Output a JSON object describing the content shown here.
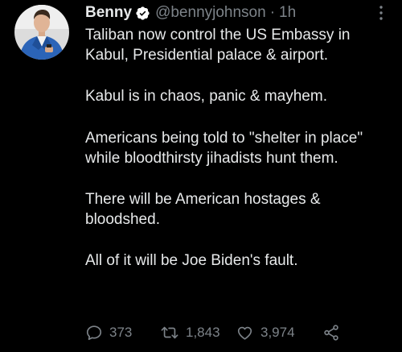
{
  "tweet": {
    "author": {
      "name": "Benny",
      "handle": "@bennyjohnson",
      "time": "1h"
    },
    "separator": "·",
    "body": [
      "Taliban now control the US Embassy in Kabul, Presidential palace & airport.",
      "Kabul is in chaos, panic & mayhem.",
      "Americans being told to \"shelter in place\" while bloodthirsty jihadists hunt them.",
      "There will be American hostages & bloodshed.",
      "All of it will be Joe Biden's fault."
    ],
    "actions": {
      "replies": "373",
      "retweets": "1,843",
      "likes": "3,974"
    },
    "icons": {
      "verified": "verified-badge-icon",
      "more": "more-options-icon",
      "reply": "reply-icon",
      "retweet": "retweet-icon",
      "like": "heart-icon",
      "share": "share-icon"
    },
    "colors": {
      "background": "#000000",
      "text": "#e7e9ea",
      "secondary": "#7d8389",
      "verified": "#ffffff"
    }
  }
}
